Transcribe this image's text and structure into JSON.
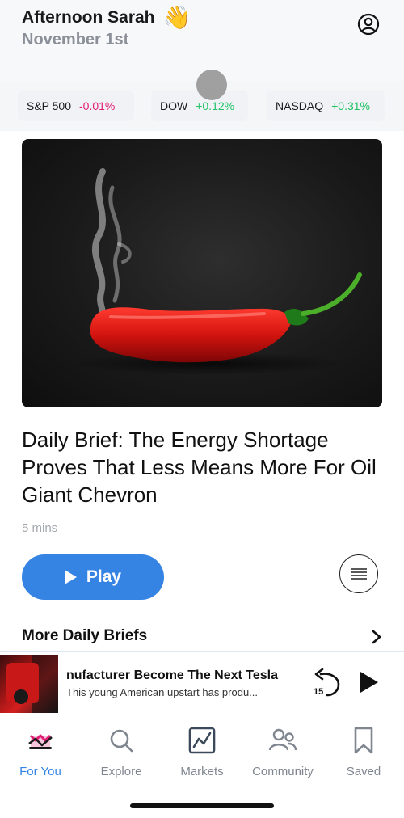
{
  "header": {
    "greeting": "Afternoon Sarah",
    "greeting_emoji": "👋",
    "date": "November 1st"
  },
  "tickers": [
    {
      "name": "S&P 500",
      "change": "-0.01%",
      "direction": "down"
    },
    {
      "name": "DOW",
      "change": "+0.12%",
      "direction": "up"
    },
    {
      "name": "NASDAQ",
      "change": "+0.31%",
      "direction": "up"
    }
  ],
  "featured": {
    "title": "Daily Brief: The Energy Shortage Proves That Less Means More For Oil Giant Chevron",
    "read_time": "5 mins",
    "play_label": "Play"
  },
  "more_briefs": {
    "label": "More Daily Briefs"
  },
  "mini_player": {
    "title": "nufacturer Become The Next Tesla",
    "subtitle": "This young American upstart has produ...",
    "rewind_seconds": "15"
  },
  "tabbar": {
    "items": [
      {
        "label": "For You",
        "icon": "for-you-icon",
        "active": true
      },
      {
        "label": "Explore",
        "icon": "search-icon",
        "active": false
      },
      {
        "label": "Markets",
        "icon": "chart-icon",
        "active": false
      },
      {
        "label": "Community",
        "icon": "people-icon",
        "active": false
      },
      {
        "label": "Saved",
        "icon": "bookmark-icon",
        "active": false
      }
    ]
  },
  "colors": {
    "accent": "#3584e4",
    "negative": "#e11d74",
    "positive": "#21c266",
    "muted": "#8a8f98"
  }
}
